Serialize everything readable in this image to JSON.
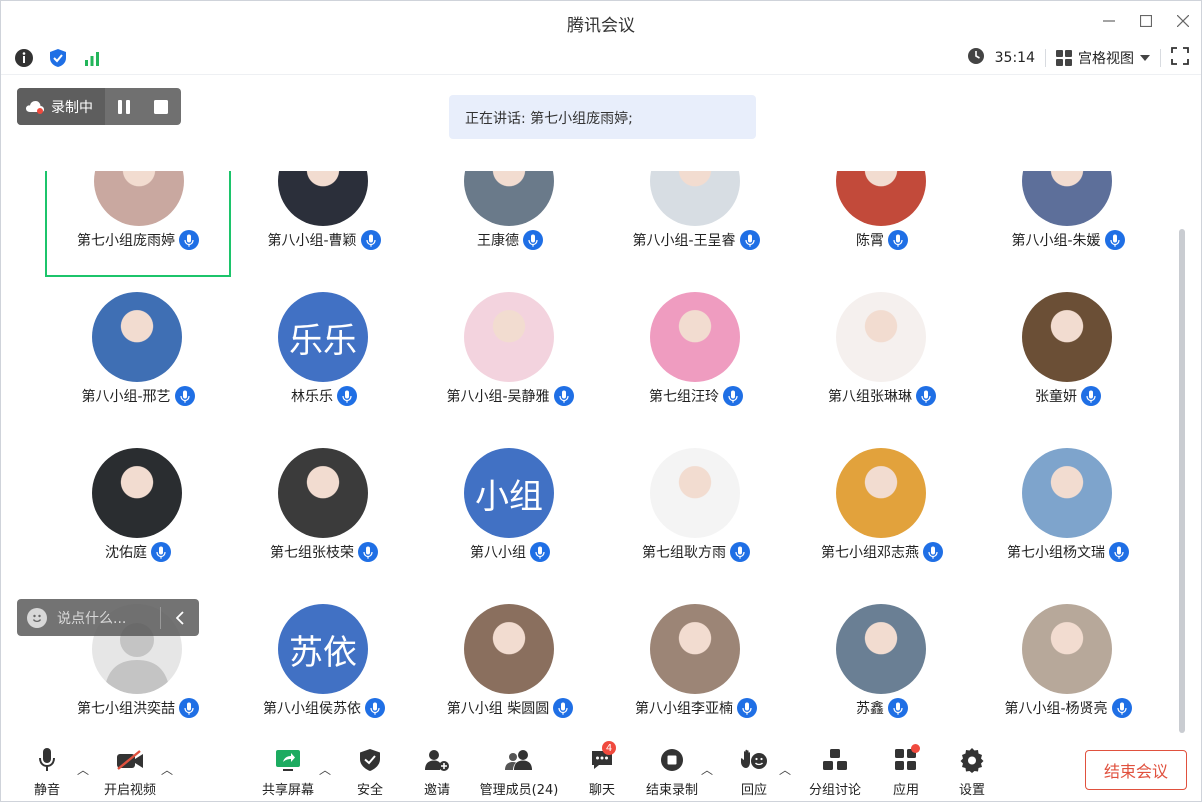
{
  "window": {
    "title": "腾讯会议"
  },
  "infobar": {
    "timer": "35:14",
    "view_mode": "宫格视图"
  },
  "recording": {
    "label": "录制中"
  },
  "speaking": {
    "text": "正在讲话: 第七小组庞雨婷;"
  },
  "participants": [
    {
      "name": "第七小组庞雨婷",
      "avatar_text": "",
      "color": "#c9a8a0",
      "active": true
    },
    {
      "name": "第八小组-曹颖",
      "avatar_text": "",
      "color": "#2b2f3a"
    },
    {
      "name": "王康德",
      "avatar_text": "",
      "color": "#6a7a8a"
    },
    {
      "name": "第八小组-王呈睿",
      "avatar_text": "",
      "color": "#d7dde3"
    },
    {
      "name": "陈霄",
      "avatar_text": "",
      "color": "#c24a3a"
    },
    {
      "name": "第八小组-朱媛",
      "avatar_text": "",
      "color": "#5d6f9a"
    },
    {
      "name": "第八小组-邢艺",
      "avatar_text": "",
      "color": "#3f6fb4"
    },
    {
      "name": "林乐乐",
      "avatar_text": "乐乐",
      "color": "#4171c4"
    },
    {
      "name": "第八小组-吴静雅",
      "avatar_text": "",
      "color": "#f3d3de"
    },
    {
      "name": "第七组汪玲",
      "avatar_text": "",
      "color": "#ef9cc0"
    },
    {
      "name": "第八组张琳琳",
      "avatar_text": "",
      "color": "#f5f0ee"
    },
    {
      "name": "张童妍",
      "avatar_text": "",
      "color": "#6b4f36"
    },
    {
      "name": "沈佑庭",
      "avatar_text": "",
      "color": "#2a2d30"
    },
    {
      "name": "第七组张枝荣",
      "avatar_text": "",
      "color": "#3b3b3b"
    },
    {
      "name": "第八小组",
      "avatar_text": "小组",
      "color": "#4171c4"
    },
    {
      "name": "第七组耿方雨",
      "avatar_text": "",
      "color": "#f4f4f4"
    },
    {
      "name": "第七小组邓志燕",
      "avatar_text": "",
      "color": "#e2a23c"
    },
    {
      "name": "第七小组杨文瑞",
      "avatar_text": "",
      "color": "#7ea4cc"
    },
    {
      "name": "第七小组洪奕喆",
      "avatar_text": "",
      "color": "#dcdcdc"
    },
    {
      "name": "第八小组侯苏依",
      "avatar_text": "苏依",
      "color": "#4171c4"
    },
    {
      "name": "第八小组 柴圆圆",
      "avatar_text": "",
      "color": "#8a6f5e"
    },
    {
      "name": "第八小组李亚楠",
      "avatar_text": "",
      "color": "#9c8576"
    },
    {
      "name": "苏鑫",
      "avatar_text": "",
      "color": "#6a7f94"
    },
    {
      "name": "第八小组-杨贤亮",
      "avatar_text": "",
      "color": "#b7a89a"
    }
  ],
  "chat": {
    "placeholder": "说点什么..."
  },
  "toolbar": {
    "mute": "静音",
    "video": "开启视频",
    "share": "共享屏幕",
    "security": "安全",
    "invite": "邀请",
    "members": "管理成员(24)",
    "chat": "聊天",
    "chat_badge": "4",
    "stop_record": "结束录制",
    "react": "回应",
    "breakout": "分组讨论",
    "apps": "应用",
    "settings": "设置",
    "end": "结束会议"
  },
  "colors": {
    "accent_blue": "#1f6fe5",
    "active_green": "#1cc46b",
    "danger_red": "#e0513e"
  }
}
